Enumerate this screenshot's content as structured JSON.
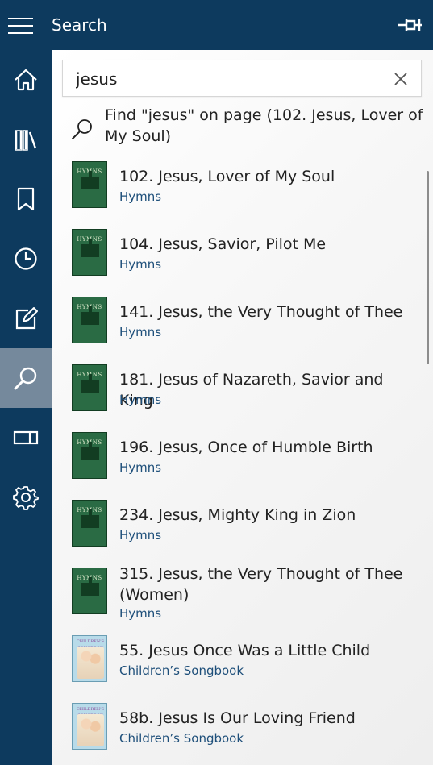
{
  "app": {
    "title": "Search"
  },
  "search": {
    "value": "jesus",
    "placeholder": ""
  },
  "find_on_page": {
    "label": "Find \"jesus\" on page (102. Jesus, Lover of My Soul)"
  },
  "colors": {
    "sidebar": "#0d3a5e",
    "active_nav": "#75899c",
    "hymns_cover": "#2a6b44",
    "link": "#1e4f7a"
  },
  "nav": [
    {
      "name": "home",
      "icon": "home-icon",
      "active": false
    },
    {
      "name": "library",
      "icon": "library-icon",
      "active": false
    },
    {
      "name": "bookmarks",
      "icon": "bookmark-icon",
      "active": false
    },
    {
      "name": "history",
      "icon": "clock-icon",
      "active": false
    },
    {
      "name": "notes",
      "icon": "edit-icon",
      "active": false
    },
    {
      "name": "search",
      "icon": "search-icon",
      "active": true
    },
    {
      "name": "screen",
      "icon": "panel-icon",
      "active": false
    },
    {
      "name": "settings",
      "icon": "gear-icon",
      "active": false
    }
  ],
  "results": [
    {
      "title": "102. Jesus, Lover of My Soul",
      "book": "Hymns",
      "cover": "hymns",
      "cover_text": "HYMNS"
    },
    {
      "title": "104. Jesus, Savior, Pilot Me",
      "book": "Hymns",
      "cover": "hymns",
      "cover_text": "HYMNS"
    },
    {
      "title": "141. Jesus, the Very Thought of Thee",
      "book": "Hymns",
      "cover": "hymns",
      "cover_text": "HYMNS"
    },
    {
      "title": "181. Jesus of Nazareth, Savior and King",
      "book": "Hymns",
      "cover": "hymns",
      "cover_text": "HYMNS"
    },
    {
      "title": "196. Jesus, Once of Humble Birth",
      "book": "Hymns",
      "cover": "hymns",
      "cover_text": "HYMNS"
    },
    {
      "title": "234. Jesus, Mighty King in Zion",
      "book": "Hymns",
      "cover": "hymns",
      "cover_text": "HYMNS"
    },
    {
      "title": "315. Jesus, the Very Thought of Thee (Women)",
      "book": "Hymns",
      "cover": "hymns",
      "cover_text": "HYMNS"
    },
    {
      "title": "55. Jesus Once Was a Little Child",
      "book": "Children’s Songbook",
      "cover": "kids",
      "cover_text": "CHILDREN'S SONGBOOK"
    },
    {
      "title": "58b. Jesus Is Our Loving Friend",
      "book": "Children’s Songbook",
      "cover": "kids",
      "cover_text": "CHILDREN'S SONGBOOK"
    }
  ]
}
